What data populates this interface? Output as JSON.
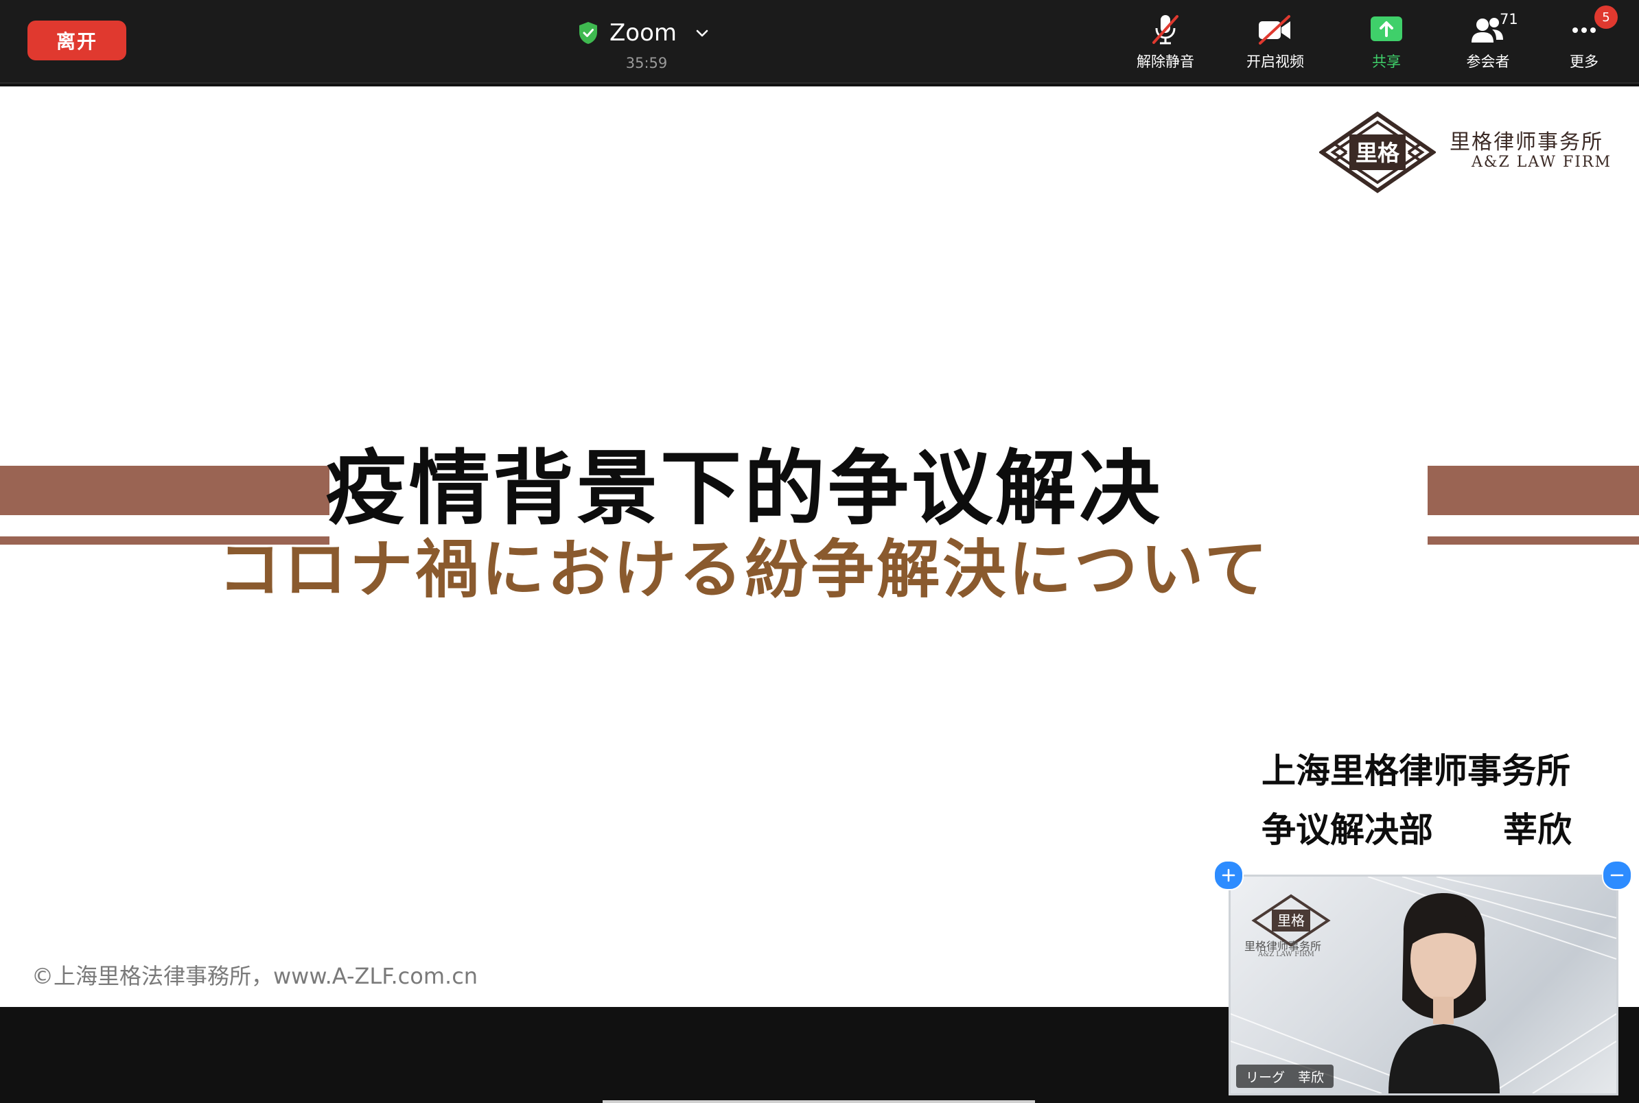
{
  "topbar": {
    "leave_label": "离开",
    "app_title": "Zoom",
    "timer": "35:59",
    "tools": {
      "unmute_label": "解除静音",
      "start_video_label": "开启视频",
      "share_label": "共享",
      "participants_label": "参会者",
      "participants_count": "71",
      "more_label": "更多",
      "more_badge": "5"
    }
  },
  "slide": {
    "logo_cn": "里格律师事务所",
    "logo_en": "A&Z LAW FIRM",
    "title": "疫情背景下的争议解决",
    "subtitle": "コロナ禍における紛争解決について",
    "firm_name": "上海里格律师事务所",
    "department": "争议解决部",
    "presenter": "莘欣",
    "copyright": "©上海里格法律事務所，www.A-ZLF.com.cn"
  },
  "video": {
    "logo_cn": "里格律师事务所",
    "logo_en": "A&Z LAW FIRM",
    "name_tag": "リーグ　莘欣"
  },
  "colors": {
    "leave": "#e0392f",
    "share_green": "#3fd06a",
    "band": "#9a6453",
    "subtitle": "#8a5a2e",
    "accent_blue": "#2d8cff"
  },
  "icons": [
    "shield-check-icon",
    "chevron-down-icon",
    "mic-muted-icon",
    "video-off-icon",
    "share-screen-icon",
    "participants-icon",
    "more-icon",
    "plus-icon",
    "minus-icon"
  ]
}
